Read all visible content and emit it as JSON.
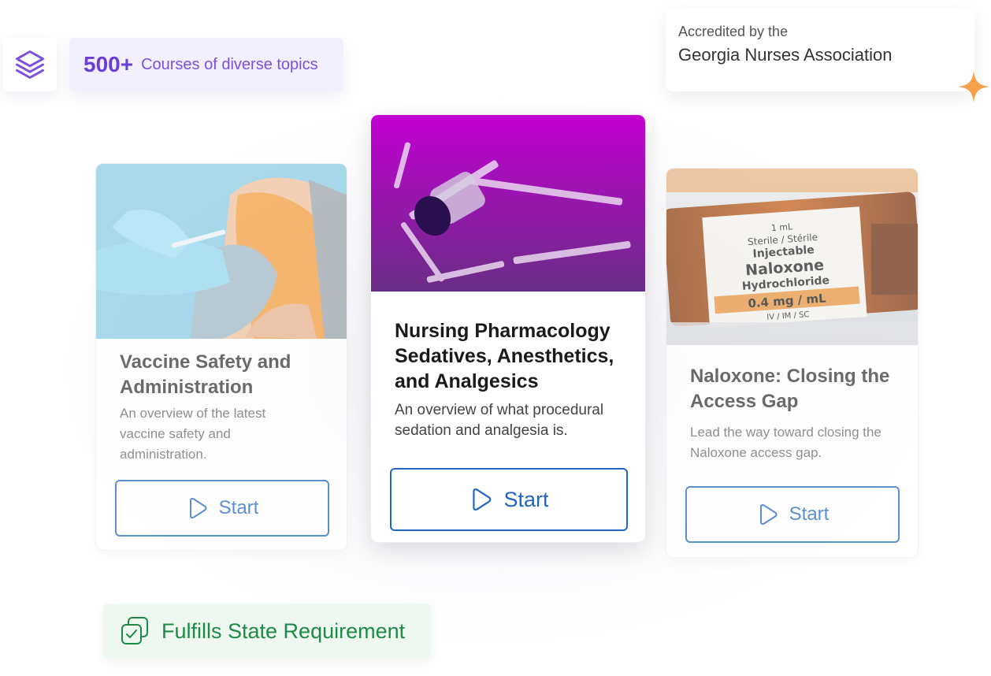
{
  "courses_badge": {
    "count": "500+",
    "text": "Courses of diverse topics"
  },
  "accreditation": {
    "prefix": "Accredited by the",
    "organization": "Georgia Nurses Association"
  },
  "cards": [
    {
      "title": "Vaccine Safety and Administration",
      "description": "An overview of the latest vaccine safety and administration.",
      "button_label": "Start",
      "image": "vaccine-injection-photo"
    },
    {
      "title": "Nursing Pharmacology Sedatives, Anesthetics, and Analgesics",
      "description": "An overview of what procedural sedation and analgesia is.",
      "button_label": "Start",
      "image": "syringes-on-purple-photo"
    },
    {
      "title": "Naloxone: Closing the Access Gap",
      "description": "Lead the way toward closing the Naloxone access gap.",
      "button_label": "Start",
      "image": "naloxone-vial-photo",
      "vial_label": {
        "volume": "1 mL",
        "sterile": "Sterile / Stérile",
        "type": "Injectable",
        "drug": "Naloxone",
        "form": "Hydrochloride",
        "dose": "0.4 mg / mL",
        "route": "IV / IM / SC"
      }
    }
  ],
  "fulfills_badge": {
    "text": "Fulfills State Requirement"
  },
  "colors": {
    "accent_purple": "#6b3fd6",
    "button_blue": "#1f66c2",
    "green": "#1d8a45",
    "orange": "#f5a04a"
  }
}
